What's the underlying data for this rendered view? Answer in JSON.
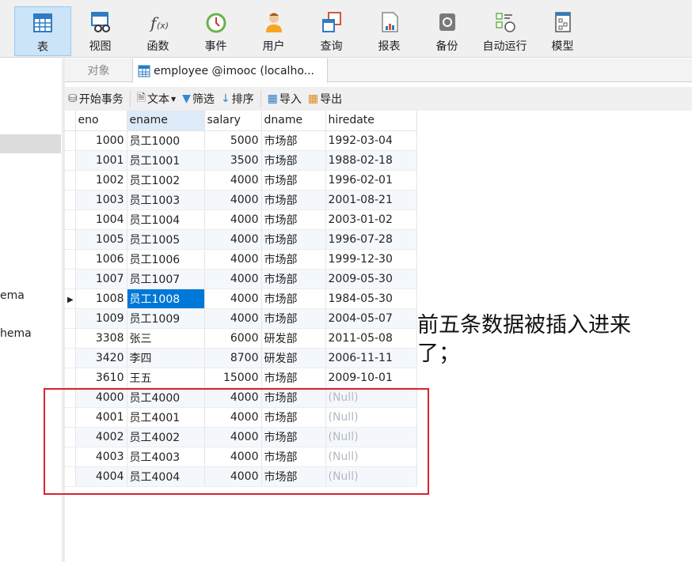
{
  "ribbon": [
    {
      "label": "表",
      "icon": "table-icon",
      "active": true
    },
    {
      "label": "视图",
      "icon": "view-icon"
    },
    {
      "label": "函数",
      "icon": "function-icon"
    },
    {
      "label": "事件",
      "icon": "event-clock-icon"
    },
    {
      "label": "用户",
      "icon": "user-icon"
    },
    {
      "label": "查询",
      "icon": "query-icon"
    },
    {
      "label": "报表",
      "icon": "report-icon"
    },
    {
      "label": "备份",
      "icon": "backup-icon"
    },
    {
      "label": "自动运行",
      "icon": "automation-icon"
    },
    {
      "label": "模型",
      "icon": "model-icon"
    }
  ],
  "left": {
    "items": [
      "ema",
      "hema"
    ]
  },
  "tabs": {
    "objects": "对象",
    "active": "employee @imooc (localho..."
  },
  "toolbar": {
    "begin": "开始事务",
    "text": "文本",
    "filter": "筛选",
    "sort": "排序",
    "import": "导入",
    "export": "导出"
  },
  "columns": [
    "eno",
    "ename",
    "salary",
    "dname",
    "hiredate"
  ],
  "rows": [
    [
      "1000",
      "员工1000",
      "5000",
      "市场部",
      "1992-03-04"
    ],
    [
      "1001",
      "员工1001",
      "3500",
      "市场部",
      "1988-02-18"
    ],
    [
      "1002",
      "员工1002",
      "4000",
      "市场部",
      "1996-02-01"
    ],
    [
      "1003",
      "员工1003",
      "4000",
      "市场部",
      "2001-08-21"
    ],
    [
      "1004",
      "员工1004",
      "4000",
      "市场部",
      "2003-01-02"
    ],
    [
      "1005",
      "员工1005",
      "4000",
      "市场部",
      "1996-07-28"
    ],
    [
      "1006",
      "员工1006",
      "4000",
      "市场部",
      "1999-12-30"
    ],
    [
      "1007",
      "员工1007",
      "4000",
      "市场部",
      "2009-05-30"
    ],
    [
      "1008",
      "员工1008",
      "4000",
      "市场部",
      "1984-05-30"
    ],
    [
      "1009",
      "员工1009",
      "4000",
      "市场部",
      "2004-05-07"
    ],
    [
      "3308",
      "张三",
      "6000",
      "研发部",
      "2011-05-08"
    ],
    [
      "3420",
      "李四",
      "8700",
      "研发部",
      "2006-11-11"
    ],
    [
      "3610",
      "王五",
      "15000",
      "市场部",
      "2009-10-01"
    ],
    [
      "4000",
      "员工4000",
      "4000",
      "市场部",
      "(Null)"
    ],
    [
      "4001",
      "员工4001",
      "4000",
      "市场部",
      "(Null)"
    ],
    [
      "4002",
      "员工4002",
      "4000",
      "市场部",
      "(Null)"
    ],
    [
      "4003",
      "员工4003",
      "4000",
      "市场部",
      "(Null)"
    ],
    [
      "4004",
      "员工4004",
      "4000",
      "市场部",
      "(Null)"
    ]
  ],
  "selected_row": 8,
  "annotation": "前五条数据被插入进来了；",
  "colors": {
    "accent": "#0078d7",
    "highlight": "#d9232e"
  }
}
